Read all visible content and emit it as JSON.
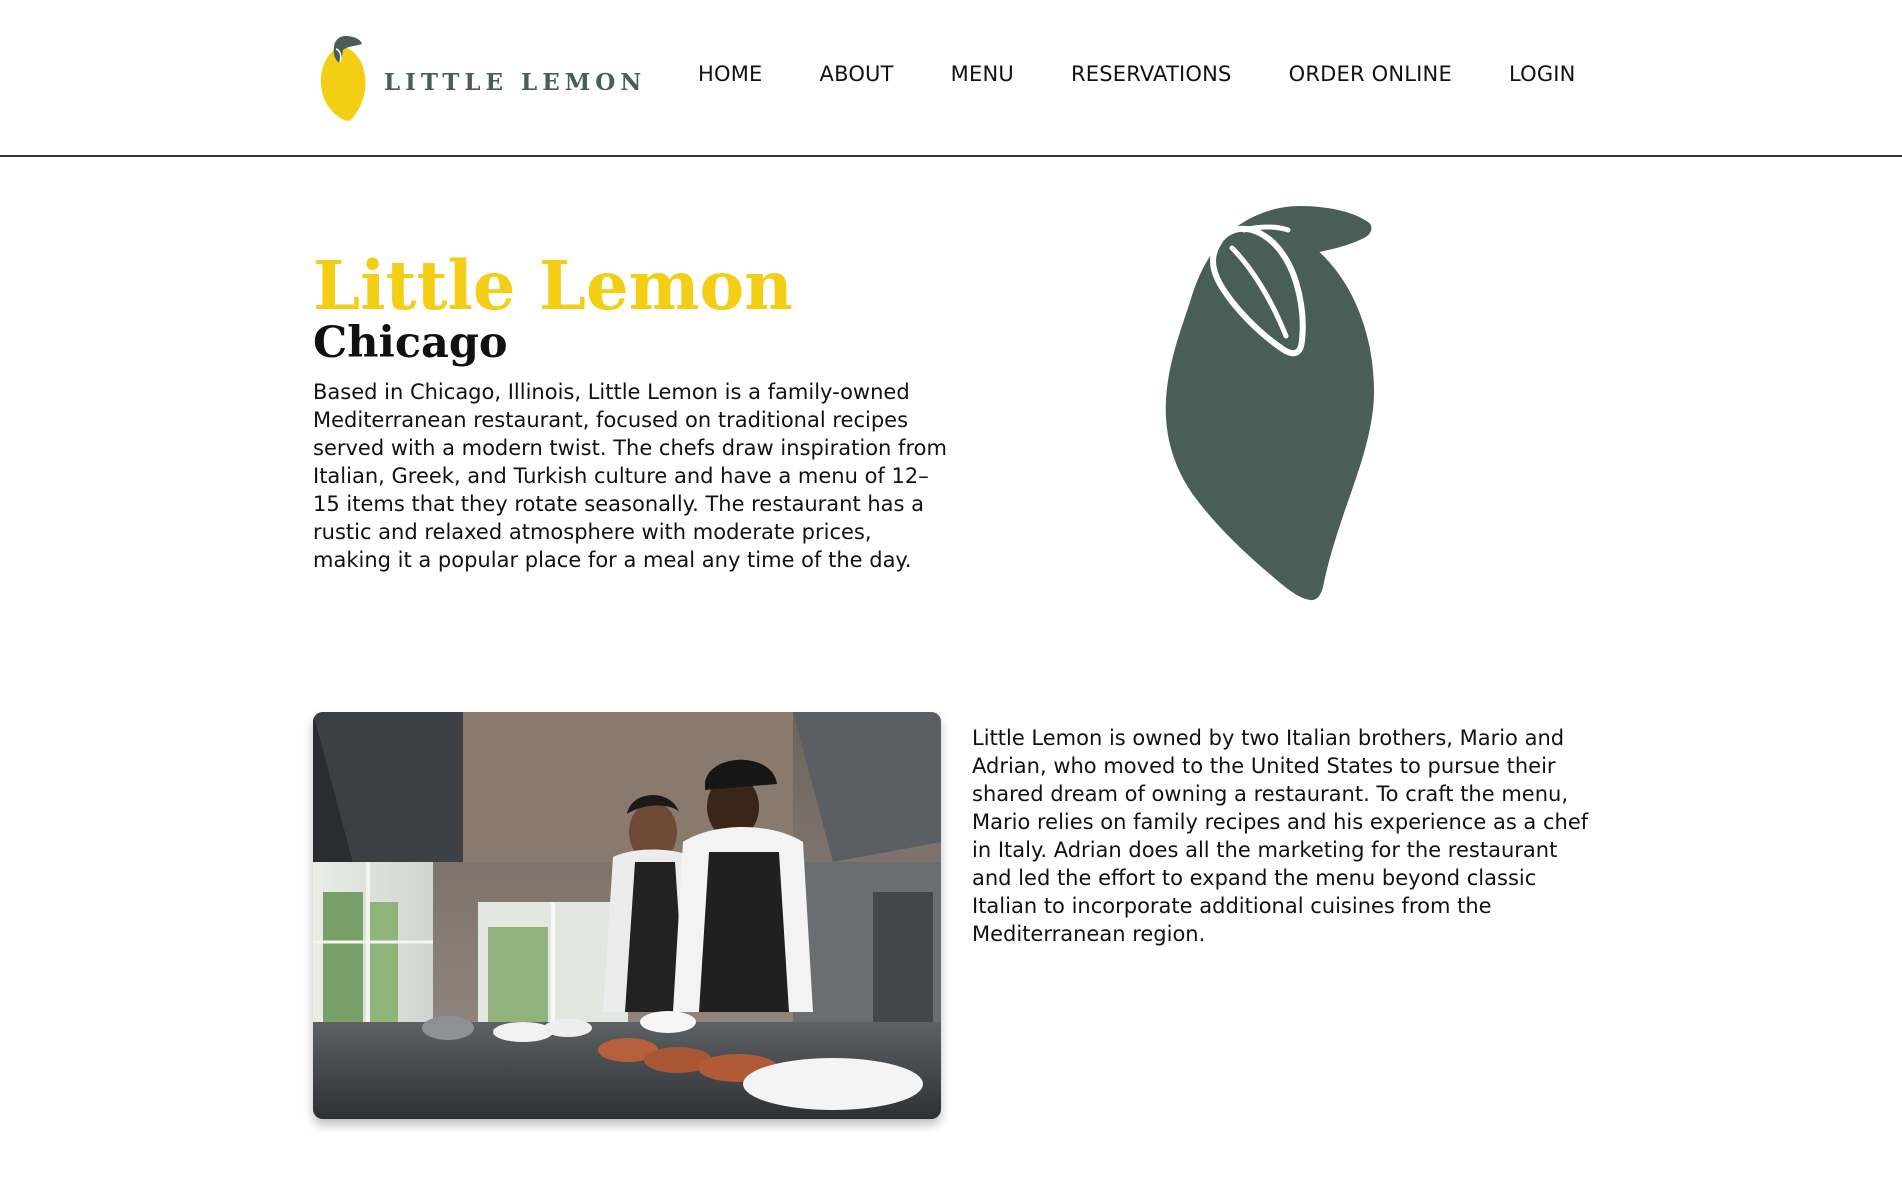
{
  "header": {
    "logo_text": "LITTLE LEMON",
    "nav": [
      {
        "label": "HOME"
      },
      {
        "label": "ABOUT"
      },
      {
        "label": "MENU"
      },
      {
        "label": "RESERVATIONS"
      },
      {
        "label": "ORDER ONLINE"
      },
      {
        "label": "LOGIN"
      }
    ]
  },
  "hero": {
    "title": "Little Lemon",
    "subtitle": "Chicago",
    "description": "Based in Chicago, Illinois, Little Lemon is a family-owned Mediterranean restaurant, focused on traditional recipes served with a modern twist. The chefs draw inspiration from Italian, Greek, and Turkish culture and have a menu of 12–15 items that they rotate seasonally. The restaurant has a rustic and relaxed atmosphere with moderate prices, making it a popular place for a meal any time of the day."
  },
  "owners": {
    "description": "Little Lemon is owned by two Italian brothers, Mario and Adrian, who moved to the United States to pursue their shared dream of owning a restaurant. To craft the menu, Mario relies on family recipes and his experience as a chef in Italy. Adrian does all the marketing for the restaurant and led the effort to expand the menu beyond classic Italian to incorporate additional cuisines from the Mediterranean region."
  },
  "icons": {
    "logo": "lemon-logo-icon",
    "hero_illustration": "lemon-illustration-icon",
    "photo": "chefs-cooking-photo"
  },
  "colors": {
    "primary_yellow": "#f4ce14",
    "primary_green": "#495e57",
    "text": "#111111",
    "background": "#ffffff"
  }
}
